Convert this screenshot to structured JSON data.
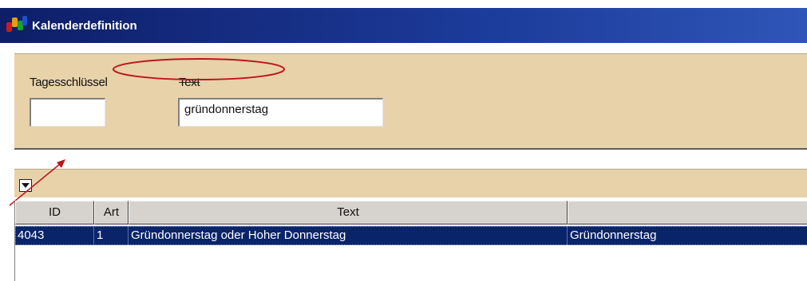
{
  "window": {
    "title": "Kalenderdefinition",
    "icon": "calendar-app-icon"
  },
  "filter": {
    "day_key_label": "Tagesschlüssel",
    "day_key_value": "",
    "text_label": "Text",
    "text_value": "gründonnerstag"
  },
  "results": {
    "dropdown_icon": "dropdown-arrow-icon",
    "columns": [
      "ID",
      "Art",
      "Text",
      ""
    ],
    "rows": [
      {
        "id": "4043",
        "art": "1",
        "text": "Gründonnerstag oder Hoher Donnerstag",
        "extra": "Gründonnerstag"
      }
    ]
  },
  "colors": {
    "title_bar": "#0e1e68",
    "panel_bg": "#e7d2aa",
    "selection": "#0a246a",
    "annotation": "#c0141a"
  }
}
